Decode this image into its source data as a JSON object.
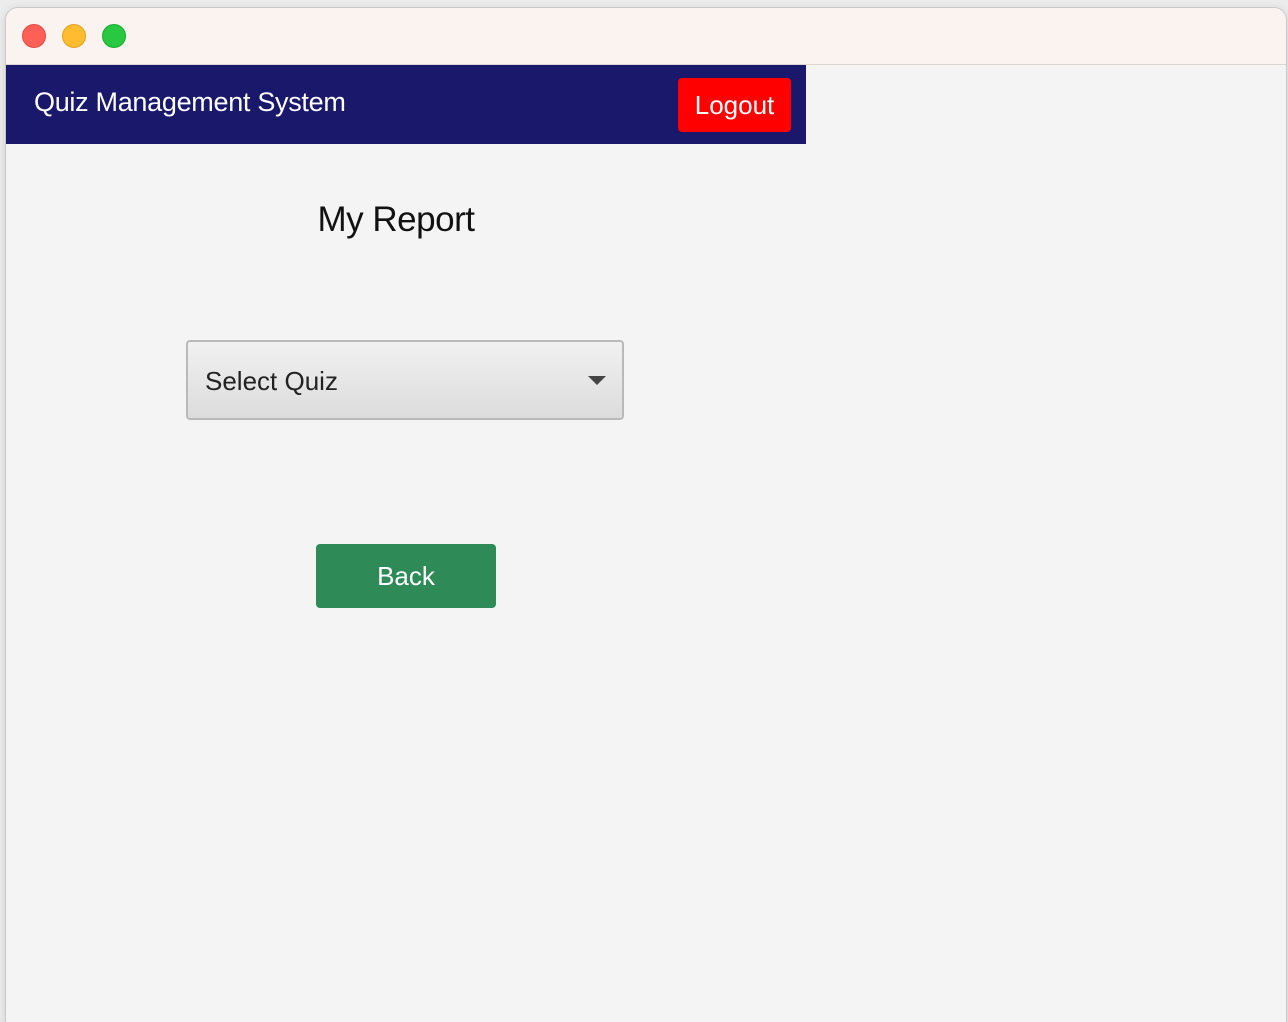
{
  "header": {
    "app_title": "Quiz Management System",
    "logout_label": "Logout"
  },
  "main": {
    "page_title": "My Report",
    "quiz_select": {
      "selected_value": "Select Quiz"
    },
    "back_label": "Back"
  },
  "colors": {
    "header_bg": "#19186b",
    "logout_bg": "#ff0000",
    "back_bg": "#2e8b57"
  },
  "icons": {
    "window_controls": [
      "close-icon",
      "minimize-icon",
      "maximize-icon"
    ],
    "select_indicator": "chevron-down-icon"
  }
}
